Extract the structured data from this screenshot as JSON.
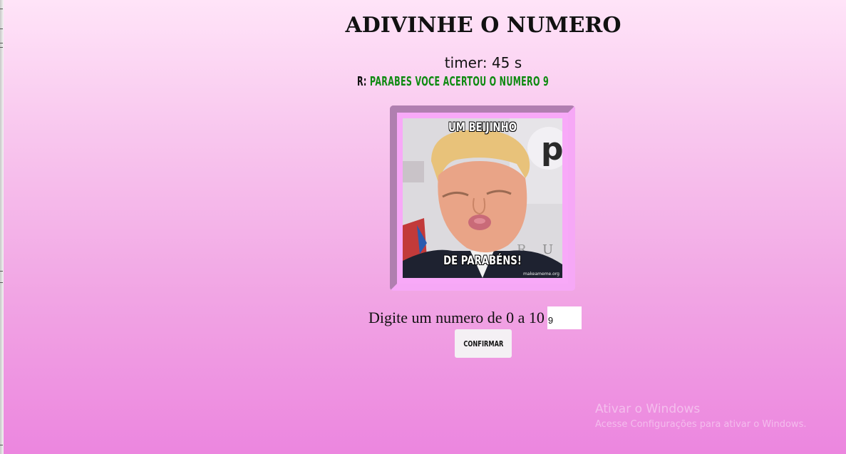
{
  "page": {
    "title": "ADIVINHE O NUMERO",
    "timer": "timer: 45 s",
    "result_prefix": "R:",
    "result_message": "PARABES VOCE ACERTOU O NUMERO 9"
  },
  "meme": {
    "top_text": "UM BEIJINHO",
    "bottom_text": "DE PARABÉNS!",
    "watermark": "makeameme.org"
  },
  "form": {
    "prompt": "Digite um numero de 0 a 10",
    "input_value": "9",
    "confirm_label": "CONFIRMAR"
  },
  "os_overlay": {
    "line1": "Ativar o Windows",
    "line2": "Acesse Configurações para ativar o Windows."
  },
  "colors": {
    "background_top": "#ffe4f8",
    "background_bottom": "#ec86df",
    "result_message": "#0f8a12",
    "frame_border": "#f8a9f8"
  }
}
